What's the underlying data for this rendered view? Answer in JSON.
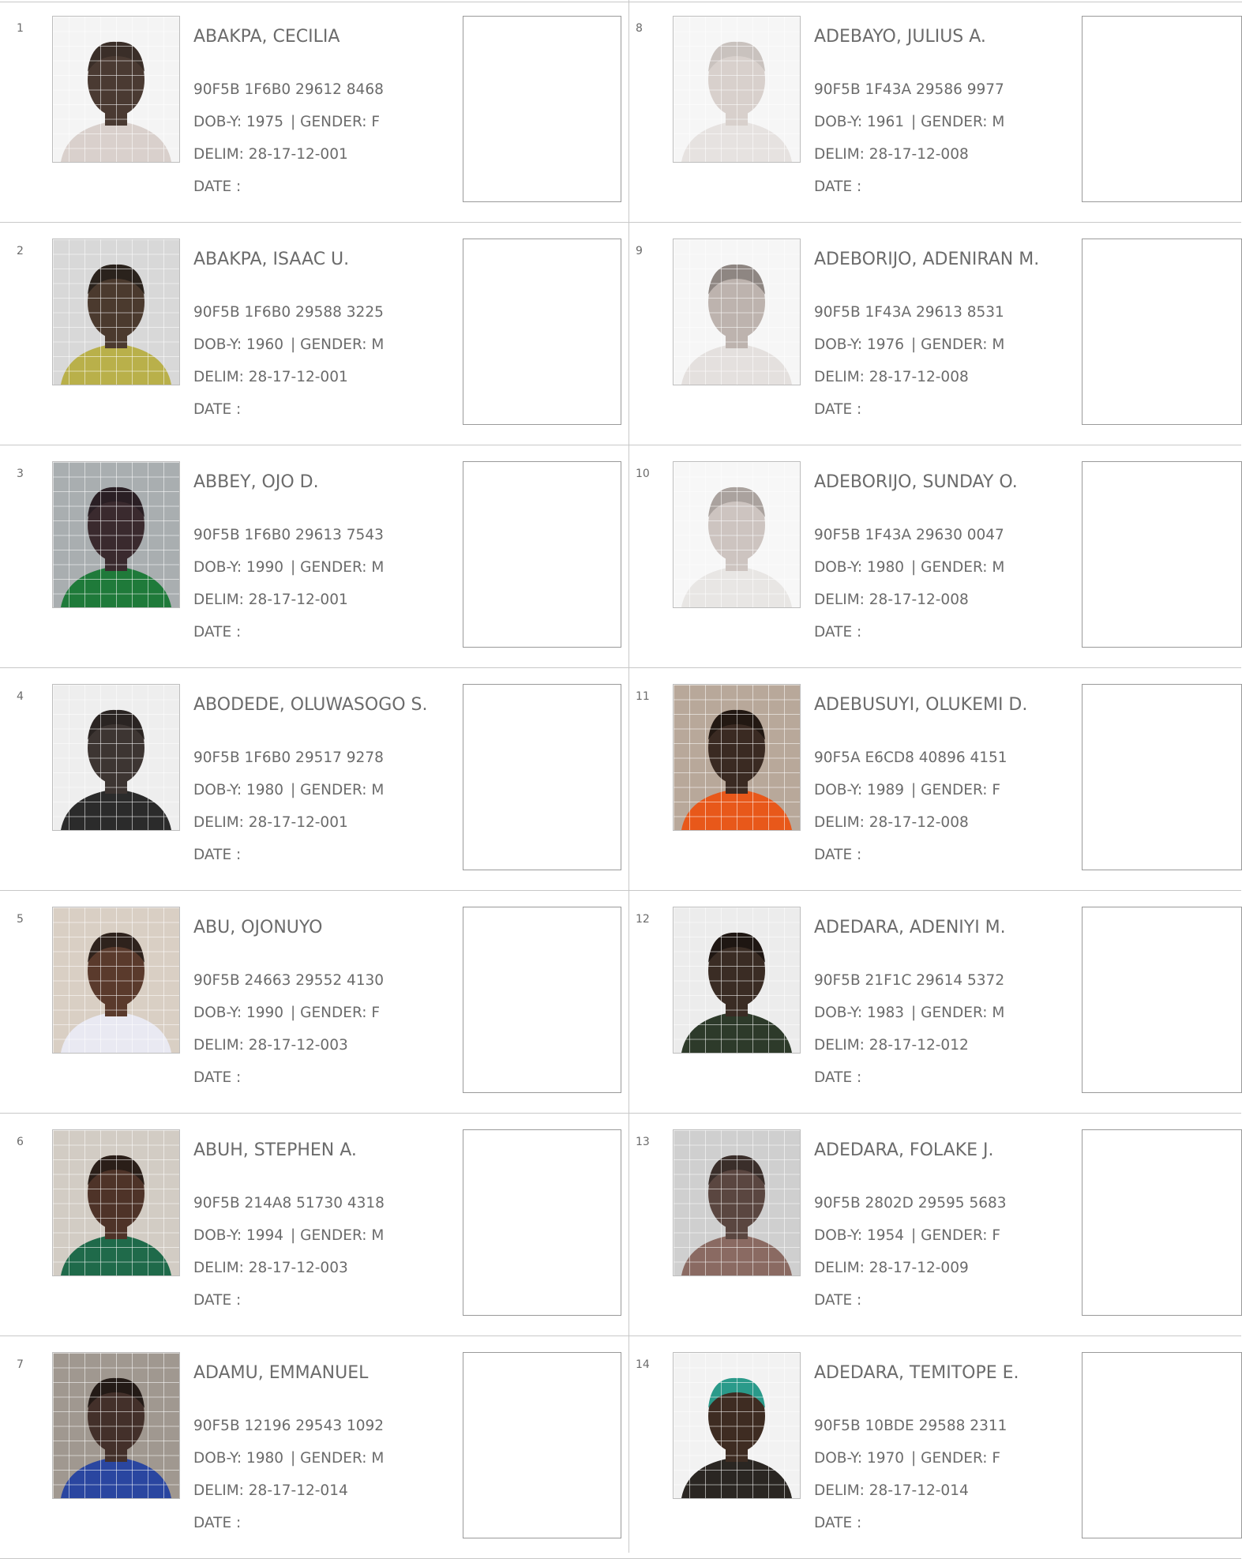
{
  "labels": {
    "dob_prefix": "DOB-Y: ",
    "gender_prefix": "| GENDER: ",
    "delim_prefix": "DELIM: ",
    "date_label": "DATE  :"
  },
  "columns": [
    {
      "voters": [
        {
          "serial": "1",
          "name": "ABAKPA, CECILIA",
          "vin": "90F5B 1F6B0 29612 8468",
          "dob_year": "1975",
          "gender": "F",
          "delim": "28-17-12-001",
          "photo": {
            "bg": "#f4f4f4",
            "skin": "#4a3a32",
            "cloth": "#d9d0cc",
            "hair": "#3a2e28"
          }
        },
        {
          "serial": "2",
          "name": "ABAKPA, ISAAC U.",
          "vin": "90F5B 1F6B0 29588 3225",
          "dob_year": "1960",
          "gender": "M",
          "delim": "28-17-12-001",
          "photo": {
            "bg": "#d8d8d8",
            "skin": "#4b3a2e",
            "cloth": "#b9b04a",
            "hair": "#2a221c"
          }
        },
        {
          "serial": "3",
          "name": "ABBEY, OJO D.",
          "vin": "90F5B 1F6B0 29613 7543",
          "dob_year": "1990",
          "gender": "M",
          "delim": "28-17-12-001",
          "photo": {
            "bg": "#a9aeb0",
            "skin": "#3a2a2e",
            "cloth": "#1f7a3a",
            "hair": "#2a1f24"
          }
        },
        {
          "serial": "4",
          "name": "ABODEDE, OLUWASOGO S.",
          "vin": "90F5B 1F6B0 29517 9278",
          "dob_year": "1980",
          "gender": "M",
          "delim": "28-17-12-001",
          "photo": {
            "bg": "#eeeeee",
            "skin": "#3d3532",
            "cloth": "#2b2b2b",
            "hair": "#2a2422"
          }
        },
        {
          "serial": "5",
          "name": "ABU, OJONUYO",
          "vin": "90F5B 24663 29552 4130",
          "dob_year": "1990",
          "gender": "F",
          "delim": "28-17-12-003",
          "photo": {
            "bg": "#d9cfc4",
            "skin": "#5a3a2c",
            "cloth": "#e9e9f2",
            "hair": "#2e221c"
          }
        },
        {
          "serial": "6",
          "name": "ABUH, STEPHEN A.",
          "vin": "90F5B 214A8 51730 4318",
          "dob_year": "1994",
          "gender": "M",
          "delim": "28-17-12-003",
          "photo": {
            "bg": "#d2ccc4",
            "skin": "#4e3328",
            "cloth": "#1f6a4a",
            "hair": "#2a1e18"
          }
        },
        {
          "serial": "7",
          "name": "ADAMU, EMMANUEL",
          "vin": "90F5B 12196 29543 1092",
          "dob_year": "1980",
          "gender": "M",
          "delim": "28-17-12-014",
          "photo": {
            "bg": "#a09890",
            "skin": "#43302a",
            "cloth": "#2a46a0",
            "hair": "#231a16"
          }
        }
      ]
    },
    {
      "voters": [
        {
          "serial": "8",
          "name": "ADEBAYO, JULIUS A.",
          "vin": "90F5B 1F43A 29586 9977",
          "dob_year": "1961",
          "gender": "M",
          "delim": "28-17-12-008",
          "photo": {
            "bg": "#f6f6f6",
            "skin": "#d8d0cc",
            "cloth": "#e6e2e0",
            "hair": "#c9c2be"
          }
        },
        {
          "serial": "9",
          "name": "ADEBORIJO, ADENIRAN M.",
          "vin": "90F5B 1F43A 29613 8531",
          "dob_year": "1976",
          "gender": "M",
          "delim": "28-17-12-008",
          "photo": {
            "bg": "#f6f6f6",
            "skin": "#bdb3ae",
            "cloth": "#e4e0de",
            "hair": "#8e8682"
          }
        },
        {
          "serial": "10",
          "name": "ADEBORIJO, SUNDAY O.",
          "vin": "90F5B 1F43A 29630 0047",
          "dob_year": "1980",
          "gender": "M",
          "delim": "28-17-12-008",
          "photo": {
            "bg": "#f7f7f7",
            "skin": "#cdc4c0",
            "cloth": "#e8e6e4",
            "hair": "#aaa29e"
          }
        },
        {
          "serial": "11",
          "name": "ADEBUSUYI, OLUKEMI D.",
          "vin": "90F5A E6CD8 40896 4151",
          "dob_year": "1989",
          "gender": "F",
          "delim": "28-17-12-008",
          "photo": {
            "bg": "#b8a89a",
            "skin": "#3a2a22",
            "cloth": "#e8581a",
            "hair": "#221812"
          }
        },
        {
          "serial": "12",
          "name": "ADEDARA, ADENIYI M.",
          "vin": "90F5B 21F1C 29614 5372",
          "dob_year": "1983",
          "gender": "M",
          "delim": "28-17-12-012",
          "photo": {
            "bg": "#ececec",
            "skin": "#3a2c24",
            "cloth": "#2d3a2a",
            "hair": "#1e1612"
          }
        },
        {
          "serial": "13",
          "name": "ADEDARA, FOLAKE J.",
          "vin": "90F5B 2802D 29595 5683",
          "dob_year": "1954",
          "gender": "F",
          "delim": "28-17-12-009",
          "photo": {
            "bg": "#cfcfcf",
            "skin": "#5a4640",
            "cloth": "#8a6a62",
            "hair": "#3a2e2a"
          }
        },
        {
          "serial": "14",
          "name": "ADEDARA, TEMITOPE E.",
          "vin": "90F5B 10BDE 29588 2311",
          "dob_year": "1970",
          "gender": "F",
          "delim": "28-17-12-014",
          "photo": {
            "bg": "#f2f2f2",
            "skin": "#3e2c22",
            "cloth": "#2a2622",
            "hair": "#2a9a8a"
          }
        }
      ]
    }
  ]
}
